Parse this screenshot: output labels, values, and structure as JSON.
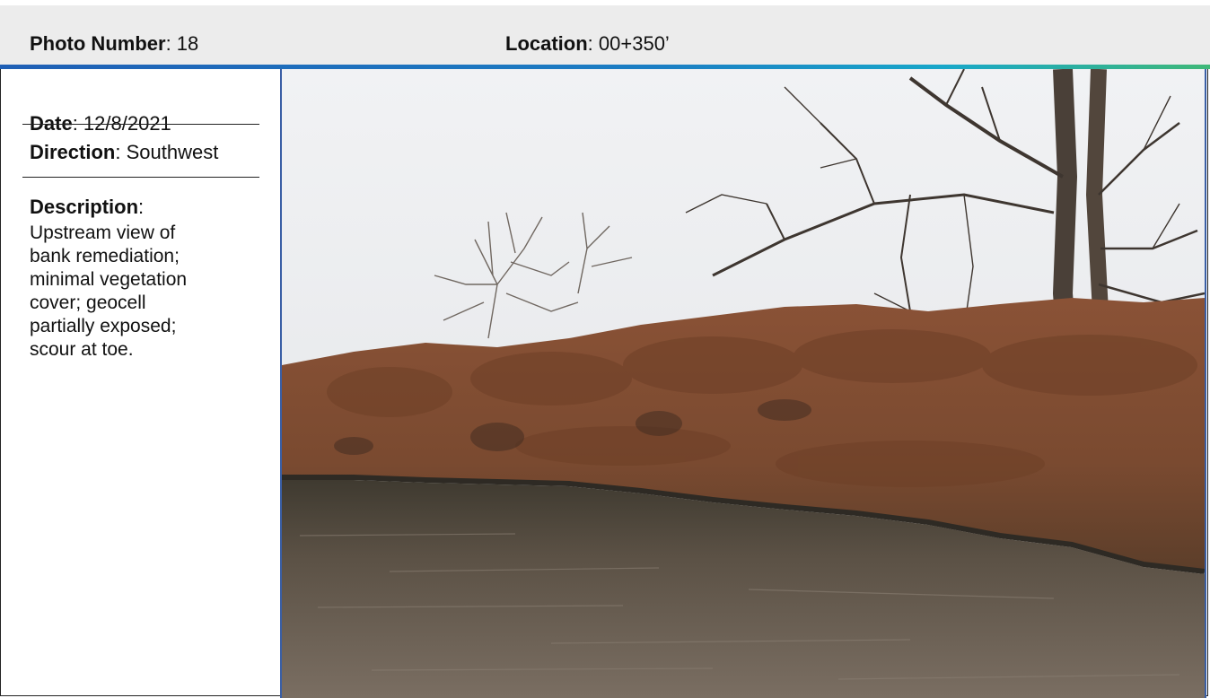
{
  "header": {
    "photo_number_label": "Photo Number",
    "photo_number_sep": ": ",
    "photo_number_value": "18",
    "location_label": "Location",
    "location_sep": ": ",
    "location_value": "00+350’"
  },
  "details": {
    "date_label": "Date",
    "date_sep": ": ",
    "date_value": "12/8/2021",
    "direction_label": "Direction",
    "direction_sep": ": ",
    "direction_value": "Southwest",
    "description_label": "Description",
    "description_sep": ":",
    "description_text": "Upstream view of\nbank remediation;\nminimal vegetation\ncover; geocell\npartially exposed;\nscour at toe."
  },
  "colors": {
    "header_bg": "#ececec",
    "accent_start": "#1f5fb5",
    "accent_end": "#3fb878",
    "photo_border": "#3a5fa5"
  },
  "photo": {
    "icon": "stream-bank-photo"
  }
}
